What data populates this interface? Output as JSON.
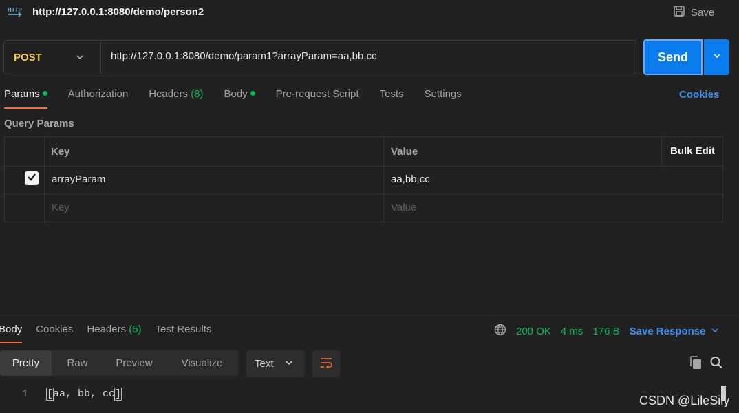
{
  "header": {
    "request_title": "http://127.0.0.1:8080/demo/person2",
    "save_label": "Save"
  },
  "request": {
    "method": "POST",
    "url": "http://127.0.0.1:8080/demo/param1?arrayParam=aa,bb,cc",
    "send_label": "Send"
  },
  "tabs": {
    "params": "Params",
    "authorization": "Authorization",
    "headers": "Headers",
    "headers_count": "(8)",
    "body": "Body",
    "prerequest": "Pre-request Script",
    "tests": "Tests",
    "settings": "Settings",
    "cookies": "Cookies"
  },
  "query_params": {
    "title": "Query Params",
    "col_key": "Key",
    "col_value": "Value",
    "bulk_edit": "Bulk Edit",
    "rows": [
      {
        "checked": true,
        "key": "arrayParam",
        "value": "aa,bb,cc"
      }
    ],
    "key_placeholder": "Key",
    "value_placeholder": "Value"
  },
  "response": {
    "tabs": {
      "body": "Body",
      "cookies": "Cookies",
      "headers": "Headers",
      "headers_count": "(5)",
      "test_results": "Test Results"
    },
    "status": "200 OK",
    "time": "4 ms",
    "size": "176 B",
    "save_response": "Save Response",
    "formats": [
      "Pretty",
      "Raw",
      "Preview",
      "Visualize"
    ],
    "selected_format": "Pretty",
    "text_type": "Text",
    "line_number": "1",
    "body_open": "[",
    "body_inner": "aa, bb, cc",
    "body_close": "]"
  },
  "watermark": "CSDN @LileSily",
  "colors": {
    "accent": "#ff6c37",
    "send_blue": "#097bed",
    "method_yellow": "#f6c646",
    "status_green": "#0cbb52",
    "link_blue": "#3d8ff2"
  },
  "icons": [
    "http-icon",
    "save-icon",
    "chevron-down-icon",
    "checkmark-icon",
    "globe-icon",
    "wrap-lines-icon",
    "copy-icon",
    "search-icon"
  ]
}
